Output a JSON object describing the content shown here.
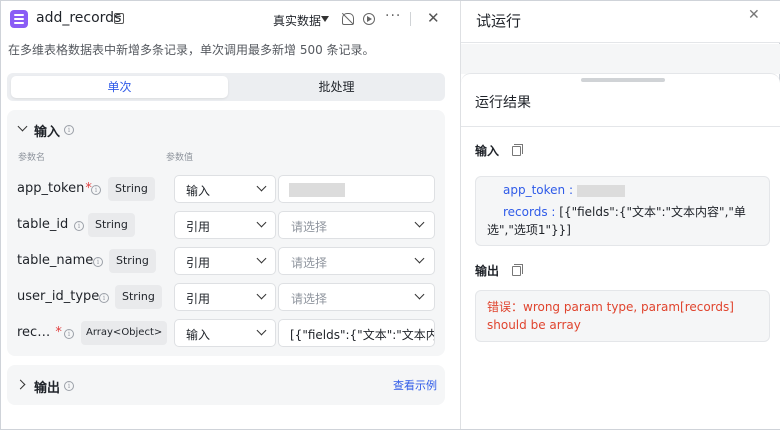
{
  "node": {
    "title": "add_records",
    "data_mode": "真实数据",
    "description": "在多维表格数据表中新增多条记录，单次调用最多新增 500 条记录。"
  },
  "mode_tabs": [
    "单次",
    "批处理"
  ],
  "input_section": {
    "title": "输入",
    "col_param": "参数名",
    "col_value": "参数值",
    "params": [
      {
        "name": "app_token",
        "required": "*",
        "type": "String",
        "source": "输入",
        "value": "",
        "placeholder": ""
      },
      {
        "name": "table_id",
        "required": "",
        "type": "String",
        "source": "引用",
        "value": "",
        "placeholder": "请选择"
      },
      {
        "name": "table_name",
        "required": "",
        "type": "String",
        "source": "引用",
        "value": "",
        "placeholder": "请选择"
      },
      {
        "name": "user_id_type",
        "required": "",
        "type": "String",
        "source": "引用",
        "value": "",
        "placeholder": "请选择"
      },
      {
        "name": "rec…",
        "required": "*",
        "type": "Array<Object>",
        "source": "输入",
        "value": "[{\"fields\":{\"文本\":\"文本内",
        "placeholder": ""
      }
    ]
  },
  "output_section": {
    "title": "输出",
    "examples_link": "查看示例"
  },
  "test_panel": {
    "title": "试运行",
    "result_title": "运行结果",
    "input_label": "输入",
    "input_app_token_key": "app_token :",
    "input_records_key": "records :",
    "input_records_line1": "[{\"fields\":{\"文本\":\"文本内容\",\"单",
    "input_records_line2": "选\",\"选项1\"}}]",
    "output_label": "输出",
    "error_text": "错误：wrong param type, param[records] should be array"
  },
  "colors": {
    "accent": "#2f5be8",
    "error": "#e0442e",
    "app_icon": "#8a5cf5"
  }
}
